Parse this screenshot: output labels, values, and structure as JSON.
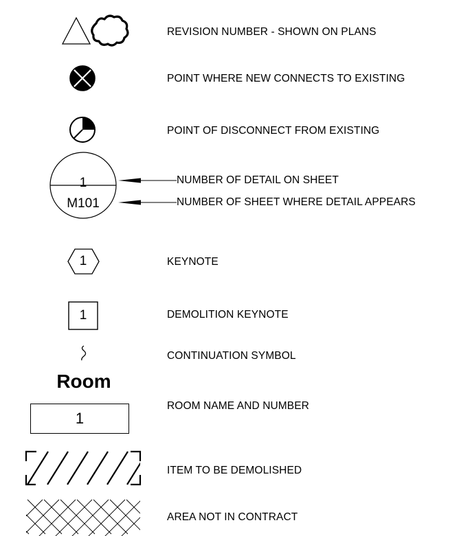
{
  "legend": {
    "rows": [
      {
        "id": "revision",
        "description": "REVISION NUMBER - SHOWN ON PLANS",
        "icon": "triangle-cloud-icon"
      },
      {
        "id": "connect",
        "description": "POINT WHERE NEW CONNECTS TO EXISTING",
        "icon": "connection-point-icon"
      },
      {
        "id": "disconnect",
        "description": "POINT OF DISCONNECT FROM EXISTING",
        "icon": "disconnect-point-icon"
      },
      {
        "id": "detail_number",
        "description": "NUMBER OF DETAIL ON SHEET"
      },
      {
        "id": "detail_sheet",
        "description": "NUMBER OF SHEET WHERE DETAIL APPEARS"
      },
      {
        "id": "keynote",
        "description": "KEYNOTE",
        "icon": "hexagon-icon"
      },
      {
        "id": "demolition_keynote",
        "description": "DEMOLITION KEYNOTE",
        "icon": "square-icon"
      },
      {
        "id": "continuation",
        "description": "CONTINUATION SYMBOL",
        "icon": "squiggle-icon"
      },
      {
        "id": "room",
        "description": "ROOM NAME AND NUMBER"
      },
      {
        "id": "demolished",
        "description": "ITEM TO BE DEMOLISHED",
        "icon": "diagonal-hatch-icon"
      },
      {
        "id": "not_in_contract",
        "description": "AREA NOT IN CONTRACT",
        "icon": "crosshatch-icon"
      }
    ],
    "detail_callout": {
      "detail": "1",
      "sheet": "M101"
    },
    "keynote_number": "1",
    "demolition_keynote_number": "1",
    "room_tag": {
      "name": "Room",
      "number": "1"
    }
  }
}
